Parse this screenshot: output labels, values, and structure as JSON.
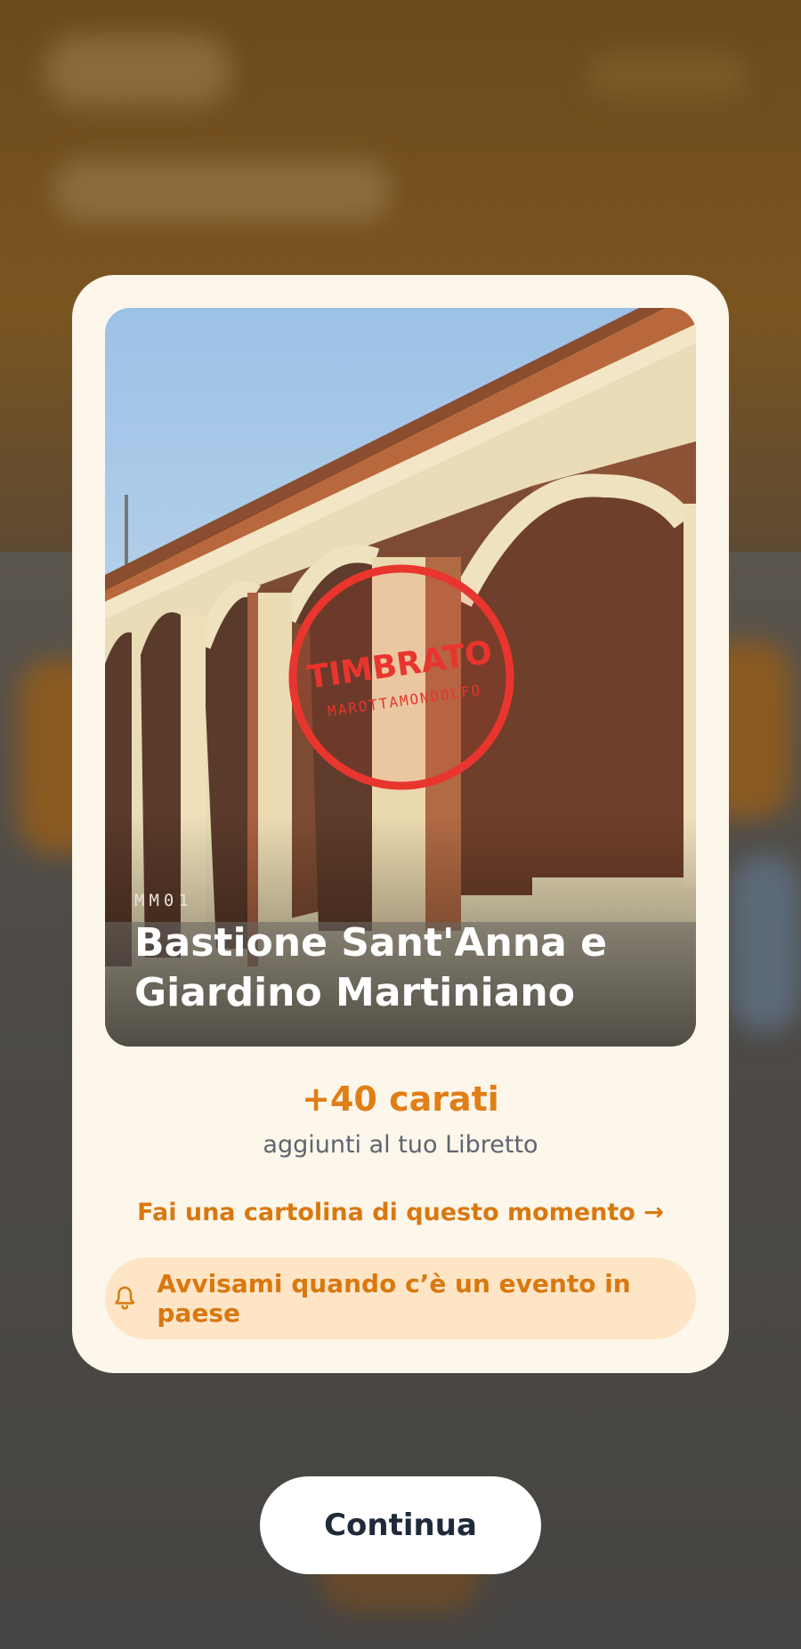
{
  "place": {
    "code": "MM01",
    "title": "Bastione Sant'Anna e Giardino Martiniano"
  },
  "stamp": {
    "label": "TIMBRATO",
    "town": "MAROTTAMONDOLFO",
    "color": "#e8352e"
  },
  "reward": {
    "carats": "+40 carati",
    "subtitle": "aggiunti al tuo Libretto"
  },
  "actions": {
    "postcard_link": "Fai una cartolina di questo momento →",
    "notify_label": "Avvisami quando c’è un evento in paese",
    "notify_icon": "bell-icon",
    "continue_label": "Continua"
  },
  "colors": {
    "accent": "#e07f16",
    "card_bg": "#fdf6ea",
    "notify_bg": "#fde5c6"
  }
}
